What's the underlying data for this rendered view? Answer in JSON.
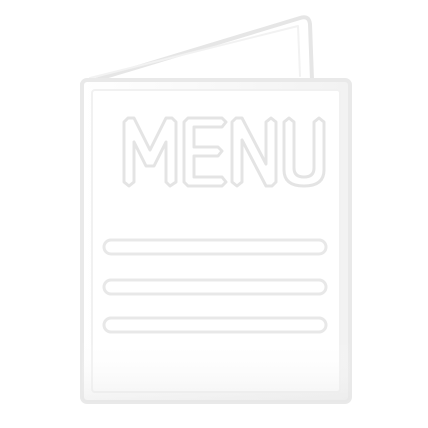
{
  "icon": {
    "name": "menu-icon",
    "title_text": "MENU",
    "colors": {
      "background": "#ffffff",
      "cover_fill": "#ffffff",
      "outline": "#e9e9e9",
      "outline_light": "#f3f3f3",
      "shadow": "#ececec"
    }
  }
}
